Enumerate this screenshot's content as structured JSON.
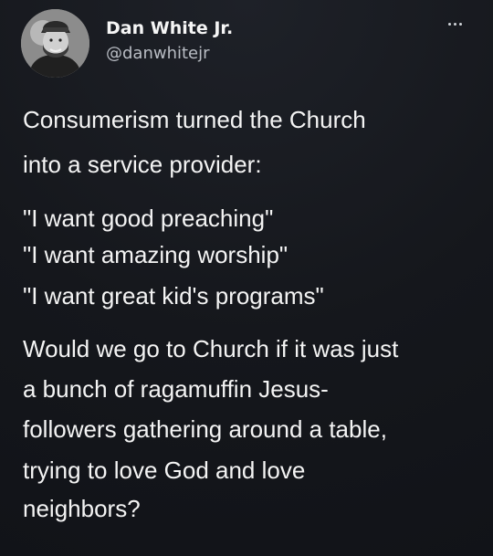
{
  "tweet": {
    "author": {
      "name": "Dan White Jr.",
      "handle": "@danwhitejr"
    },
    "body": {
      "intro": [
        "Consumerism turned the Church",
        "into a service provider:"
      ],
      "quotes": [
        "\"I want good preaching\"",
        "\"I want amazing worship\"",
        "\"I want great kid's programs\""
      ],
      "question": [
        "Would we go to Church if it was just",
        "a bunch of ragamuffin Jesus-",
        "followers gathering around a table,",
        "trying to love God and love",
        "neighbors?"
      ]
    },
    "icons": {
      "menu": "more-options-icon"
    },
    "colors": {
      "background": "#16181d",
      "text": "#f4f4f4",
      "handle": "#b9bdc4"
    }
  }
}
